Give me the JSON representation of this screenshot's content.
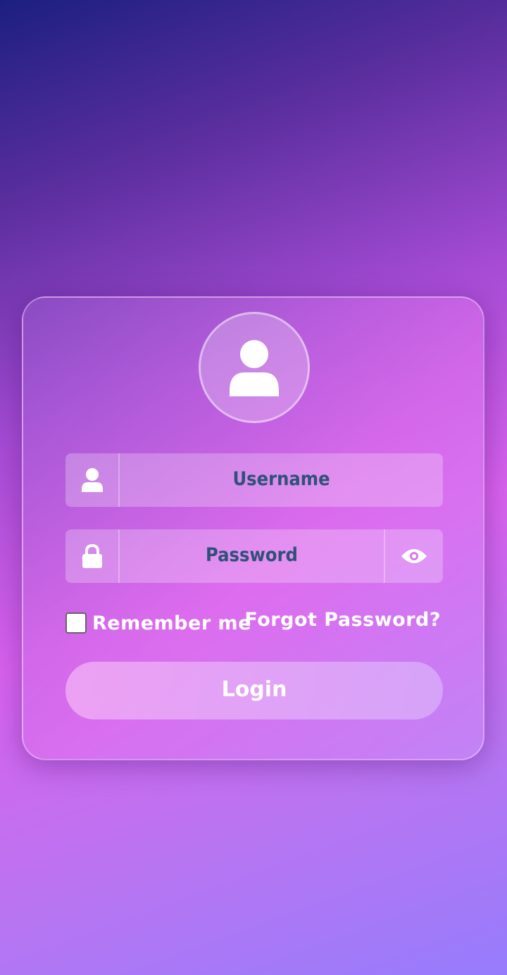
{
  "login_form": {
    "avatar_icon": "user-icon",
    "username": {
      "placeholder": "Username",
      "icon": "user-icon"
    },
    "password": {
      "placeholder": "Password",
      "icon": "lock-icon",
      "toggle_icon": "eye-icon"
    },
    "remember_me": {
      "label": "Remember me",
      "checked": false
    },
    "forgot_password_label": "Forgot Password?",
    "login_label": "Login"
  },
  "colors": {
    "placeholder_text": "#2f5179",
    "text": "#ffffff"
  }
}
